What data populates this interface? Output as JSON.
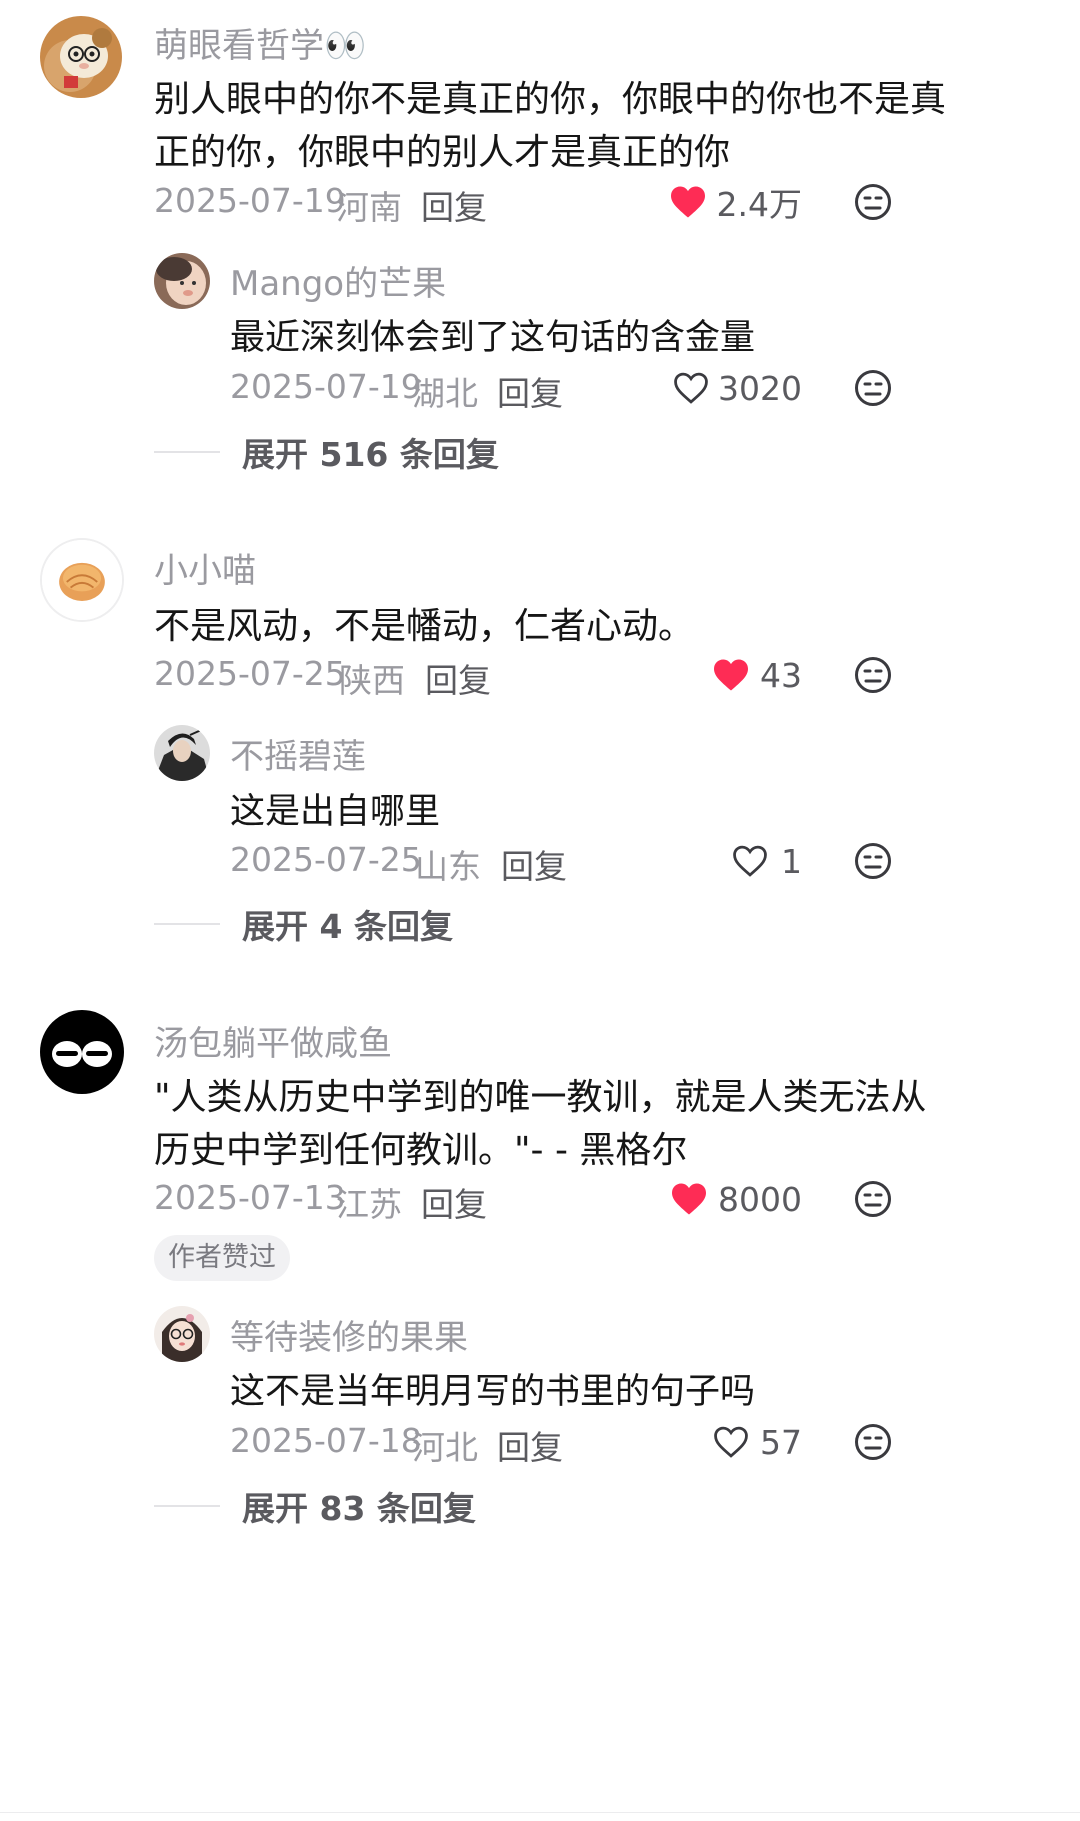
{
  "colors": {
    "liked_heart": "#fe2c55",
    "muted_text": "#9a9aa0",
    "body_text": "#161616",
    "action_text": "#5a5a5f"
  },
  "comments": [
    {
      "username": "萌眼看哲学👀",
      "text_lines": [
        "别人眼中的你不是真正的你，你眼中的你也不是真",
        "正的你，你眼中的别人才是真正的你"
      ],
      "date": "2025-07-19",
      "location": "河南",
      "reply_label": "回复",
      "like_count": "2.4万",
      "liked": true,
      "avatar_icon": "plush-toy-avatar",
      "reply": {
        "username": "Mango的芒果",
        "text": "最近深刻体会到了这句话的含金量",
        "date": "2025-07-19",
        "location": "湖北",
        "reply_label": "回复",
        "like_count": "3020",
        "liked": false,
        "avatar_icon": "baby-photo-avatar"
      },
      "expand_label": "展开 516 条回复"
    },
    {
      "username": "小小喵",
      "text_lines": [
        "不是风动，不是幡动，仁者心动。"
      ],
      "date": "2025-07-25",
      "location": "陕西",
      "reply_label": "回复",
      "like_count": "43",
      "liked": true,
      "avatar_icon": "orange-bun-avatar",
      "reply": {
        "username": "不摇碧莲",
        "text": "这是出自哪里",
        "date": "2025-07-25",
        "location": "山东",
        "reply_label": "回复",
        "like_count": "1",
        "liked": false,
        "avatar_icon": "swordsman-avatar"
      },
      "expand_label": "展开 4 条回复"
    },
    {
      "username": "汤包躺平做咸鱼",
      "text_lines": [
        "\"人类从历史中学到的唯一教训，就是人类无法从",
        "历史中学到任何教训。\"- - 黑格尔"
      ],
      "date": "2025-07-13",
      "location": "江苏",
      "reply_label": "回复",
      "like_count": "8000",
      "liked": true,
      "avatar_icon": "sleepy-eyes-avatar",
      "badge": "作者赞过",
      "reply": {
        "username": "等待装修的果果",
        "text": "这不是当年明月写的书里的句子吗",
        "date": "2025-07-18",
        "location": "河北",
        "reply_label": "回复",
        "like_count": "57",
        "liked": false,
        "avatar_icon": "girl-glasses-avatar"
      },
      "expand_label": "展开 83 条回复"
    }
  ]
}
